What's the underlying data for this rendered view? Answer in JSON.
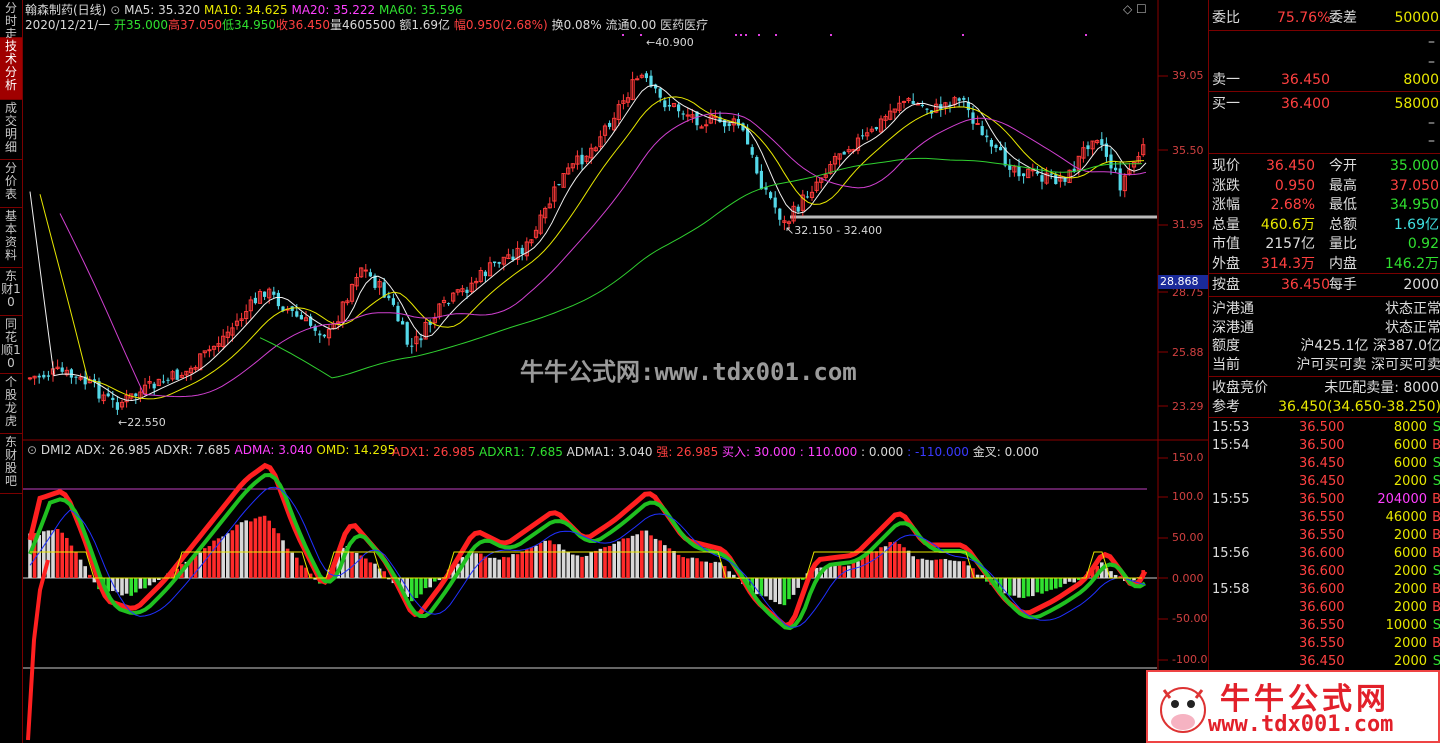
{
  "left_tabs": [
    {
      "label": "分时走势",
      "active": false
    },
    {
      "label": "技术分析",
      "active": true
    },
    {
      "label": "成交明细",
      "active": false
    },
    {
      "label": "分价表",
      "active": false
    },
    {
      "label": "基本资料",
      "active": false
    },
    {
      "label": "东财10",
      "active": false
    },
    {
      "label": "同花顺10",
      "active": false
    },
    {
      "label": "个股龙虎",
      "active": false
    },
    {
      "label": "东财股吧",
      "active": false
    }
  ],
  "header": {
    "stock": "翰森制药(日线)",
    "ma5": "MA5: 35.320",
    "ma10": "MA10: 34.625",
    "ma20": "MA20: 35.222",
    "ma60": "MA60: 35.596",
    "date": "2020/12/21/一",
    "open": "开35.000",
    "high": "高37.050",
    "low": "低34.950",
    "close": "收36.450",
    "vol": "量4605500",
    "amount": "额1.69亿",
    "range": "幅0.950(2.68%)",
    "turnover": "换0.08%",
    "float": "流通0.00",
    "sector": "医药医疗"
  },
  "price_axis": [
    "39.05",
    "35.50",
    "31.95",
    "28.75",
    "25.88",
    "23.29"
  ],
  "price_tag": "28.868",
  "annotations": {
    "high": "40.900",
    "low": "22.550",
    "range": "32.150 - 32.400"
  },
  "watermark": "牛牛公式网:www.tdx001.com",
  "indicator": {
    "name": "DMI2",
    "adx": "ADX: 26.985",
    "adxr": "ADXR: 7.685",
    "adma": "ADMA: 3.040",
    "omd": "OMD: 14.295",
    "adx1": "ADX1: 26.985",
    "adxr1": "ADXR1: 7.685",
    "adma1": "ADMA1: 3.040",
    "strong": "强: 26.985",
    "buy": "买入: 30.000",
    "v110": ": 110.000",
    "v0": ": 0.000",
    "vneg": ": -110.000",
    "cross": "金叉: 0.000"
  },
  "ind_axis": [
    "150.0",
    "100.0",
    "50.00",
    "0.000",
    "-50.00",
    "-100.0"
  ],
  "quote": {
    "wb_label": "委比",
    "wb": "75.76%",
    "wc_label": "委差",
    "wc": "50000",
    "dash1": "–",
    "dash2": "–",
    "sell1_label": "卖一",
    "sell1_price": "36.450",
    "sell1_vol": "8000",
    "buy1_label": "买一",
    "buy1_price": "36.400",
    "buy1_vol": "58000",
    "dash3": "–",
    "dash4": "–",
    "rows": [
      [
        "现价",
        "36.450",
        "今开",
        "35.000"
      ],
      [
        "涨跌",
        "0.950",
        "最高",
        "37.050"
      ],
      [
        "涨幅",
        "2.68%",
        "最低",
        "34.950"
      ],
      [
        "总量",
        "460.6万",
        "总额",
        "1.69亿"
      ],
      [
        "市值",
        "2157亿",
        "量比",
        "0.92"
      ],
      [
        "外盘",
        "314.3万",
        "内盘",
        "146.2万"
      ]
    ],
    "pan_label": "按盘",
    "pan": "36.450",
    "lot_label": "每手",
    "lot": "2000",
    "hk1": "沪港通",
    "hk1s": "状态正常",
    "hk2": "深港通",
    "hk2s": "状态正常",
    "quota_label": "额度",
    "quota": "沪425.1亿 深387.0亿",
    "now_label": "当前",
    "now": "沪可买可卖 深可买可卖",
    "auction_label": "收盘竞价",
    "auction": "未匹配卖量: 8000",
    "ref_label": "参考",
    "ref": "36.450(34.650-38.250)"
  },
  "ticks": [
    [
      "15:53",
      "36.500",
      "8000",
      "S"
    ],
    [
      "15:54",
      "36.500",
      "6000",
      "B"
    ],
    [
      "",
      "36.450",
      "6000",
      "S"
    ],
    [
      "",
      "36.450",
      "2000",
      "S"
    ],
    [
      "15:55",
      "36.500",
      "204000",
      "B"
    ],
    [
      "",
      "36.550",
      "46000",
      "B"
    ],
    [
      "",
      "36.550",
      "2000",
      "B"
    ],
    [
      "15:56",
      "36.600",
      "6000",
      "B"
    ],
    [
      "",
      "36.600",
      "2000",
      "S"
    ],
    [
      "15:58",
      "36.600",
      "2000",
      "B"
    ],
    [
      "",
      "36.600",
      "2000",
      "B"
    ],
    [
      "",
      "36.550",
      "10000",
      "S"
    ],
    [
      "",
      "36.550",
      "2000",
      "B"
    ],
    [
      "",
      "36.450",
      "2000",
      "S"
    ]
  ],
  "logo": {
    "title": "牛牛公式网",
    "url": "www.tdx001.com"
  }
}
